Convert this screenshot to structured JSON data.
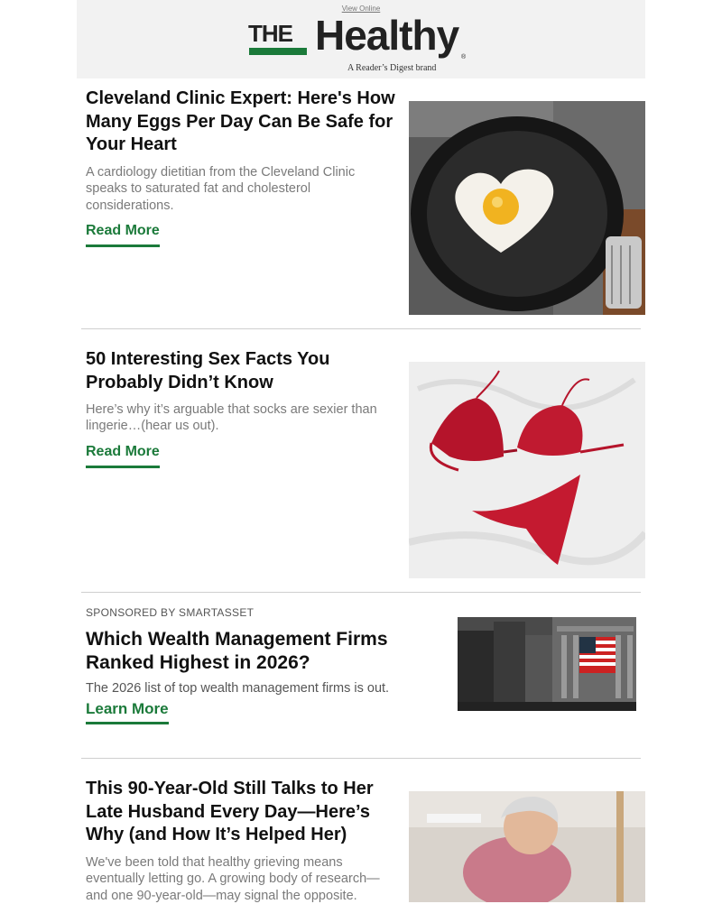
{
  "header": {
    "view_online": "View Online",
    "logo_the": "THE",
    "logo_healthy": "Healthy",
    "logo_reg": "®",
    "tagline": "A Reader’s Digest brand"
  },
  "articles": [
    {
      "title": "Cleveland Clinic Expert: Here's How Many Eggs Per Day Can Be Safe for Your Heart",
      "description": "A cardiology dietitian from the Cleveland Clinic speaks to saturated fat and cholesterol considerations.",
      "cta": "Read More"
    },
    {
      "title": "50 Interesting Sex Facts You Probably Didn’t Know",
      "description": "Here’s why it’s arguable that socks are sexier than lingerie…(hear us out).",
      "cta": "Read More"
    },
    {
      "sponsor": "SPONSORED BY SMARTASSET",
      "title": "Which Wealth Management Firms Ranked Highest in 2026?",
      "description": "The 2026 list of top wealth management firms is out.",
      "cta": "Learn More"
    },
    {
      "title": "This 90-Year-Old Still Talks to Her Late Husband Every Day—Here’s Why (and How It’s Helped Her)",
      "description": "We've been told that healthy grieving means eventually letting go. A growing body of research—and one 90-year-old—may signal the opposite."
    }
  ],
  "colors": {
    "accent": "#1b7a3a",
    "header_bg": "#f2f2f2",
    "muted_text": "#7a7a7a"
  }
}
